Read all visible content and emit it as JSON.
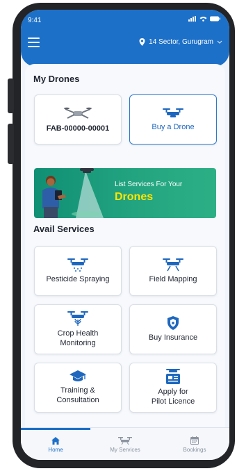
{
  "status_bar": {
    "time": "9:41"
  },
  "header": {
    "location": "14 Sector, Gurugram",
    "accent": "#1d70c8"
  },
  "my_drones": {
    "title": "My Drones",
    "drone_id": "FAB-00000-00001",
    "buy_label": "Buy a Drone"
  },
  "banner": {
    "line1": "List Services For Your",
    "line2": "Drones"
  },
  "avail_services": {
    "title": "Avail Services",
    "items": [
      {
        "label": "Pesticide Spraying",
        "icon": "spray-drone-icon"
      },
      {
        "label": "Field Mapping",
        "icon": "mapping-drone-icon"
      },
      {
        "label": "Crop Health\nMonitoring",
        "icon": "crop-drone-icon"
      },
      {
        "label": "Buy Insurance",
        "icon": "shield-icon"
      },
      {
        "label": "Training &\nConsultation",
        "icon": "graduation-cap-icon"
      },
      {
        "label": "Apply for\nPilot Licence",
        "icon": "licence-icon"
      }
    ]
  },
  "bottom_nav": [
    {
      "label": "Home",
      "icon": "home-icon",
      "active": true
    },
    {
      "label": "My Services",
      "icon": "drone-icon",
      "active": false
    },
    {
      "label": "Bookings",
      "icon": "calendar-icon",
      "active": false
    }
  ]
}
